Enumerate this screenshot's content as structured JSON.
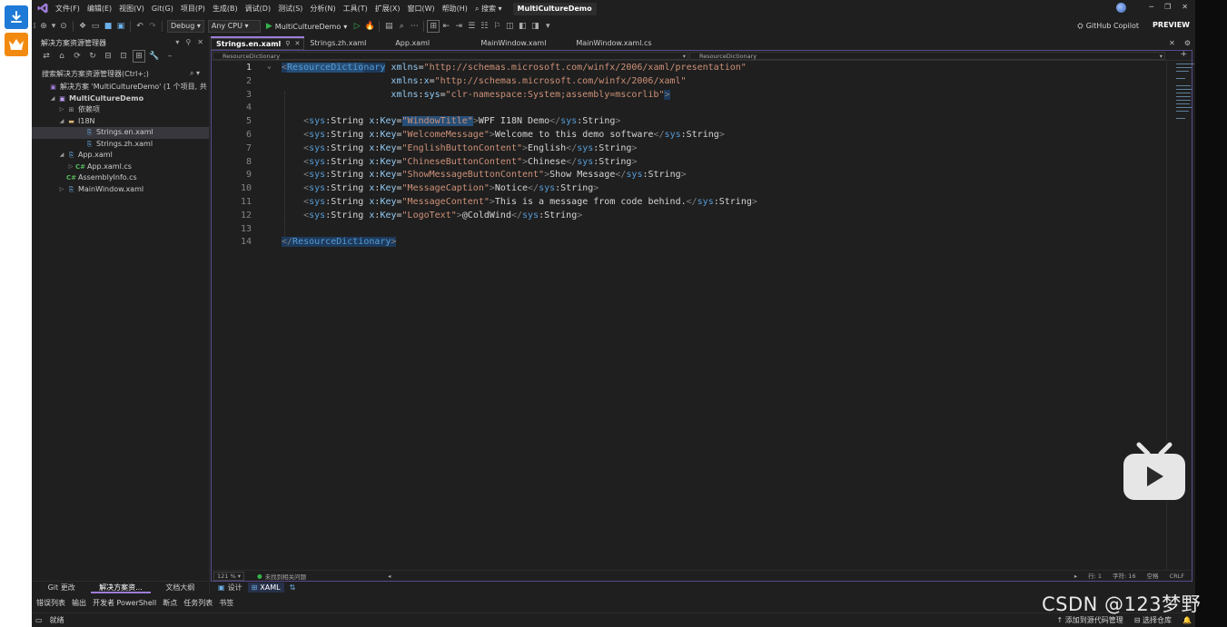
{
  "window": {
    "solution_title": "MultiCultureDemo",
    "menu": [
      "文件(F)",
      "编辑(E)",
      "视图(V)",
      "Git(G)",
      "项目(P)",
      "生成(B)",
      "调试(D)",
      "测试(S)",
      "分析(N)",
      "工具(T)",
      "扩展(X)",
      "窗口(W)",
      "帮助(H)"
    ],
    "search_label": "搜索"
  },
  "toolbar": {
    "config": "Debug",
    "platform": "Any CPU",
    "run_target": "MultiCultureDemo",
    "copilot": "GitHub Copilot",
    "preview": "PREVIEW"
  },
  "solution_explorer": {
    "title": "解决方案资源管理器",
    "search_placeholder": "搜索解决方案资源管理器(Ctrl+;)",
    "tree": [
      {
        "label": "解决方案 'MultiCultureDemo' (1 个项目, 共",
        "icon": "solution-icon",
        "indent": 0,
        "arrow": ""
      },
      {
        "label": "MultiCultureDemo",
        "icon": "project-icon",
        "indent": 1,
        "arrow": "open",
        "bold": true
      },
      {
        "label": "依赖项",
        "icon": "dependencies-icon",
        "indent": 2,
        "arrow": "closed"
      },
      {
        "label": "I18N",
        "icon": "folder-icon",
        "indent": 2,
        "arrow": "open"
      },
      {
        "label": "Strings.en.xaml",
        "icon": "xaml-file-icon",
        "indent": 4,
        "arrow": "",
        "selected": true
      },
      {
        "label": "Strings.zh.xaml",
        "icon": "xaml-file-icon",
        "indent": 4,
        "arrow": ""
      },
      {
        "label": "App.xaml",
        "icon": "xaml-file-icon",
        "indent": 2,
        "arrow": "open"
      },
      {
        "label": "App.xaml.cs",
        "icon": "csharp-file-icon",
        "indent": 3,
        "arrow": "closed"
      },
      {
        "label": "AssemblyInfo.cs",
        "icon": "csharp-file-icon",
        "indent": 2,
        "arrow": ""
      },
      {
        "label": "MainWindow.xaml",
        "icon": "xaml-file-icon",
        "indent": 2,
        "arrow": "closed"
      }
    ],
    "bottom_tabs": [
      "Git 更改",
      "解决方案资...",
      "文档大纲"
    ]
  },
  "editor": {
    "tabs": [
      {
        "label": "Strings.en.xaml",
        "active": true
      },
      {
        "label": "Strings.zh.xaml",
        "active": false
      },
      {
        "label": "App.xaml",
        "active": false
      },
      {
        "label": "MainWindow.xaml",
        "active": false
      },
      {
        "label": "MainWindow.xaml.cs",
        "active": false
      }
    ],
    "nav_left": "ResourceDictionary",
    "nav_right": "ResourceDictionary",
    "line_numbers": [
      "1",
      "2",
      "3",
      "4",
      "5",
      "6",
      "7",
      "8",
      "9",
      "10",
      "11",
      "12",
      "13",
      "14"
    ],
    "zoom": "121 %",
    "issues": "未找到相关问题",
    "position": {
      "line": "行: 1",
      "char": "字符: 16",
      "spaces": "空格",
      "eol": "CRLF"
    },
    "designer_tabs": [
      "设计",
      "XAML"
    ]
  },
  "tool_tabs": [
    "错误列表",
    "输出",
    "开发者 PowerShell",
    "断点",
    "任务列表",
    "书签"
  ],
  "statusbar": {
    "ready": "就绪",
    "add_source": "添加到源代码管理",
    "select_repo": "选择仓库"
  },
  "watermark": "CSDN @123梦野",
  "colors": {
    "vs_accent": "#9e7cd8",
    "editor_bg": "#1f1f1f",
    "xml_tag": "#569cd6",
    "xml_attr": "#92caf4",
    "xml_string": "#ce9178",
    "run_green": "#35b34a"
  }
}
